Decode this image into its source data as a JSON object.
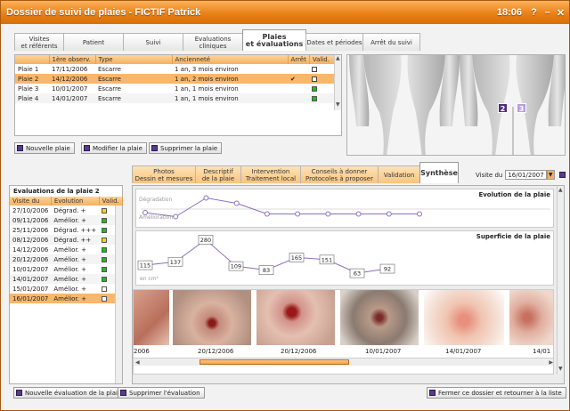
{
  "window": {
    "title": "Dossier de suivi de plaies - FICTIF Patrick",
    "time": "18:06",
    "help": "?",
    "minimize": "–",
    "close": "✕"
  },
  "main_tabs": [
    {
      "label1": "Visites",
      "label2": "et référents"
    },
    {
      "label1": "Patient",
      "label2": ""
    },
    {
      "label1": "Suivi",
      "label2": ""
    },
    {
      "label1": "Evaluations",
      "label2": "cliniques"
    },
    {
      "label1": "Plaies",
      "label2": "et évaluations"
    },
    {
      "label1": "Dates et périodes",
      "label2": ""
    },
    {
      "label1": "Arrêt du suivi",
      "label2": ""
    }
  ],
  "wounds_table": {
    "headers": [
      "",
      "1ère observ.",
      "Type",
      "Ancienneté",
      "Arrêt",
      "Valid."
    ],
    "rows": [
      {
        "name": "Plaie 1",
        "date": "17/11/2006",
        "type": "Escarre",
        "age": "1 an, 3 mois environ",
        "stop": "",
        "valid": "white"
      },
      {
        "name": "Plaie 2",
        "date": "14/12/2006",
        "type": "Escarre",
        "age": "1 an, 2 mois environ",
        "stop": "✔",
        "valid": "white"
      },
      {
        "name": "Plaie 3",
        "date": "10/01/2007",
        "type": "Escarre",
        "age": "1 an, 1 mois environ",
        "stop": "",
        "valid": "green"
      },
      {
        "name": "Plaie 4",
        "date": "14/01/2007",
        "type": "Escarre",
        "age": "1 an, 1 mois environ",
        "stop": "",
        "valid": "green"
      }
    ]
  },
  "wound_buttons": {
    "new": "Nouvelle plaie",
    "edit": "Modifier la plaie",
    "delete": "Supprimer la plaie"
  },
  "body_markers": {
    "m2": "2",
    "m3": "3"
  },
  "sub_tabs": [
    {
      "label1": "Photos",
      "label2": "Dessin et mesures"
    },
    {
      "label1": "Descriptif",
      "label2": "de la plaie"
    },
    {
      "label1": "Intervention",
      "label2": "Traitement local"
    },
    {
      "label1": "Conseils à donner",
      "label2": "Protocoles à proposer"
    },
    {
      "label1": "Validation",
      "label2": ""
    },
    {
      "label1": "Synthèse",
      "label2": ""
    }
  ],
  "visit_selector": {
    "label": "Visite du",
    "value": "16/01/2007"
  },
  "evaluations": {
    "title": "Evaluations de la plaie 2",
    "headers": [
      "Visite du",
      "Evolution",
      "Valid."
    ],
    "rows": [
      {
        "date": "27/10/2006",
        "evo": "Dégrad. +",
        "valid": "yellow"
      },
      {
        "date": "09/11/2006",
        "evo": "Amélior. +",
        "valid": "green"
      },
      {
        "date": "25/11/2006",
        "evo": "Dégrad. +++",
        "valid": "green"
      },
      {
        "date": "08/12/2006",
        "evo": "Dégrad. ++",
        "valid": "yellow"
      },
      {
        "date": "14/12/2006",
        "evo": "Amélior. +",
        "valid": "green"
      },
      {
        "date": "20/12/2006",
        "evo": "Amélior. +",
        "valid": "green"
      },
      {
        "date": "10/01/2007",
        "evo": "Amélior. +",
        "valid": "green"
      },
      {
        "date": "14/01/2007",
        "evo": "Amélior. +",
        "valid": "green"
      },
      {
        "date": "15/01/2007",
        "evo": "Amélior. +",
        "valid": "white"
      },
      {
        "date": "16/01/2007",
        "evo": "Amélior. +",
        "valid": "white"
      }
    ]
  },
  "evolution_chart": {
    "title": "Evolution de la plaie",
    "top_label": "Dégradation",
    "bottom_label": "Amélioration",
    "values": [
      0.4,
      0.25,
      0.95,
      0.75,
      0.35,
      0.35,
      0.35,
      0.35,
      0.35,
      0.35
    ]
  },
  "surface_chart": {
    "title": "Superficie de la plaie",
    "unit": "en cm²",
    "values": [
      115,
      137,
      280,
      109,
      83,
      165,
      151,
      63,
      92
    ]
  },
  "photos": {
    "labels": [
      "2006",
      "20/12/2006",
      "20/12/2006",
      "10/01/2007",
      "14/01/2007",
      "14/01"
    ]
  },
  "bottom_buttons": {
    "new_eval": "Nouvelle évaluation de la plaie",
    "delete_eval": "Supprimer l'évaluation",
    "close": "Fermer ce dossier et retourner à la liste"
  },
  "colors": {
    "accent": "#e98116",
    "selected_row": "#f8b76c",
    "valid_green": "#17c21a",
    "valid_yellow": "#f5d800",
    "chart_line": "#8a6fc0"
  }
}
